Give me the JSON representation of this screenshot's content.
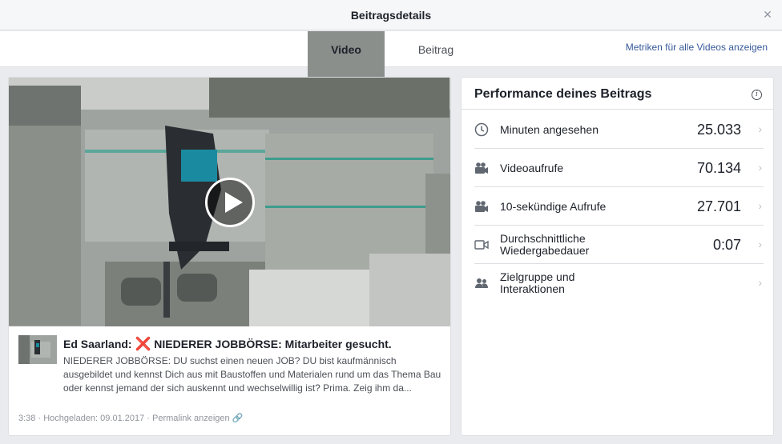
{
  "window": {
    "title": "Beitragsdetails"
  },
  "tabs": [
    {
      "label": "Video"
    },
    {
      "label": "Beitrag"
    }
  ],
  "header": {
    "metrics_link": "Metriken für alle Videos anzeigen"
  },
  "post": {
    "title_prefix": "Ed Saarland:",
    "title_emoji": "❌",
    "title_rest": "NIEDERER JOBBÖRSE: Mitarbeiter gesucht.",
    "description": "NIEDERER JOBBÖRSE: DU suchst einen neuen JOB? DU bist kaufmännisch ausgebildet und kennst Dich aus mit Baustoffen und Materialen rund um das Thema Bau oder kennst jemand der sich auskennt und wechselwillig ist? Prima. Zeig ihm da...",
    "duration": "3:38",
    "uploaded": "Hochgeladen: 09.01.2017",
    "separator": "·",
    "permalink": "Permalink anzeigen"
  },
  "performance": {
    "heading": "Performance deines Beitrags",
    "info_icon": "i",
    "rows": [
      {
        "icon": "clock-icon",
        "label": "Minuten angesehen",
        "value": "25.033"
      },
      {
        "icon": "video-camera-icon",
        "label": "Videoaufrufe",
        "value": "70.134"
      },
      {
        "icon": "video-camera-icon",
        "label": "10-sekündige Aufrufe",
        "value": "27.701"
      },
      {
        "icon": "video-outline-icon",
        "label_line1": "Durchschnittliche",
        "label_line2": "Wiedergabedauer",
        "value": "0:07"
      },
      {
        "icon": "people-icon",
        "label_line1": "Zielgruppe und",
        "label_line2": "Interaktionen",
        "value": ""
      }
    ]
  },
  "colors": {
    "accent": "#4267b2",
    "link": "#365899",
    "background": "#e9ebee",
    "emoji_red": "#e0282e"
  }
}
